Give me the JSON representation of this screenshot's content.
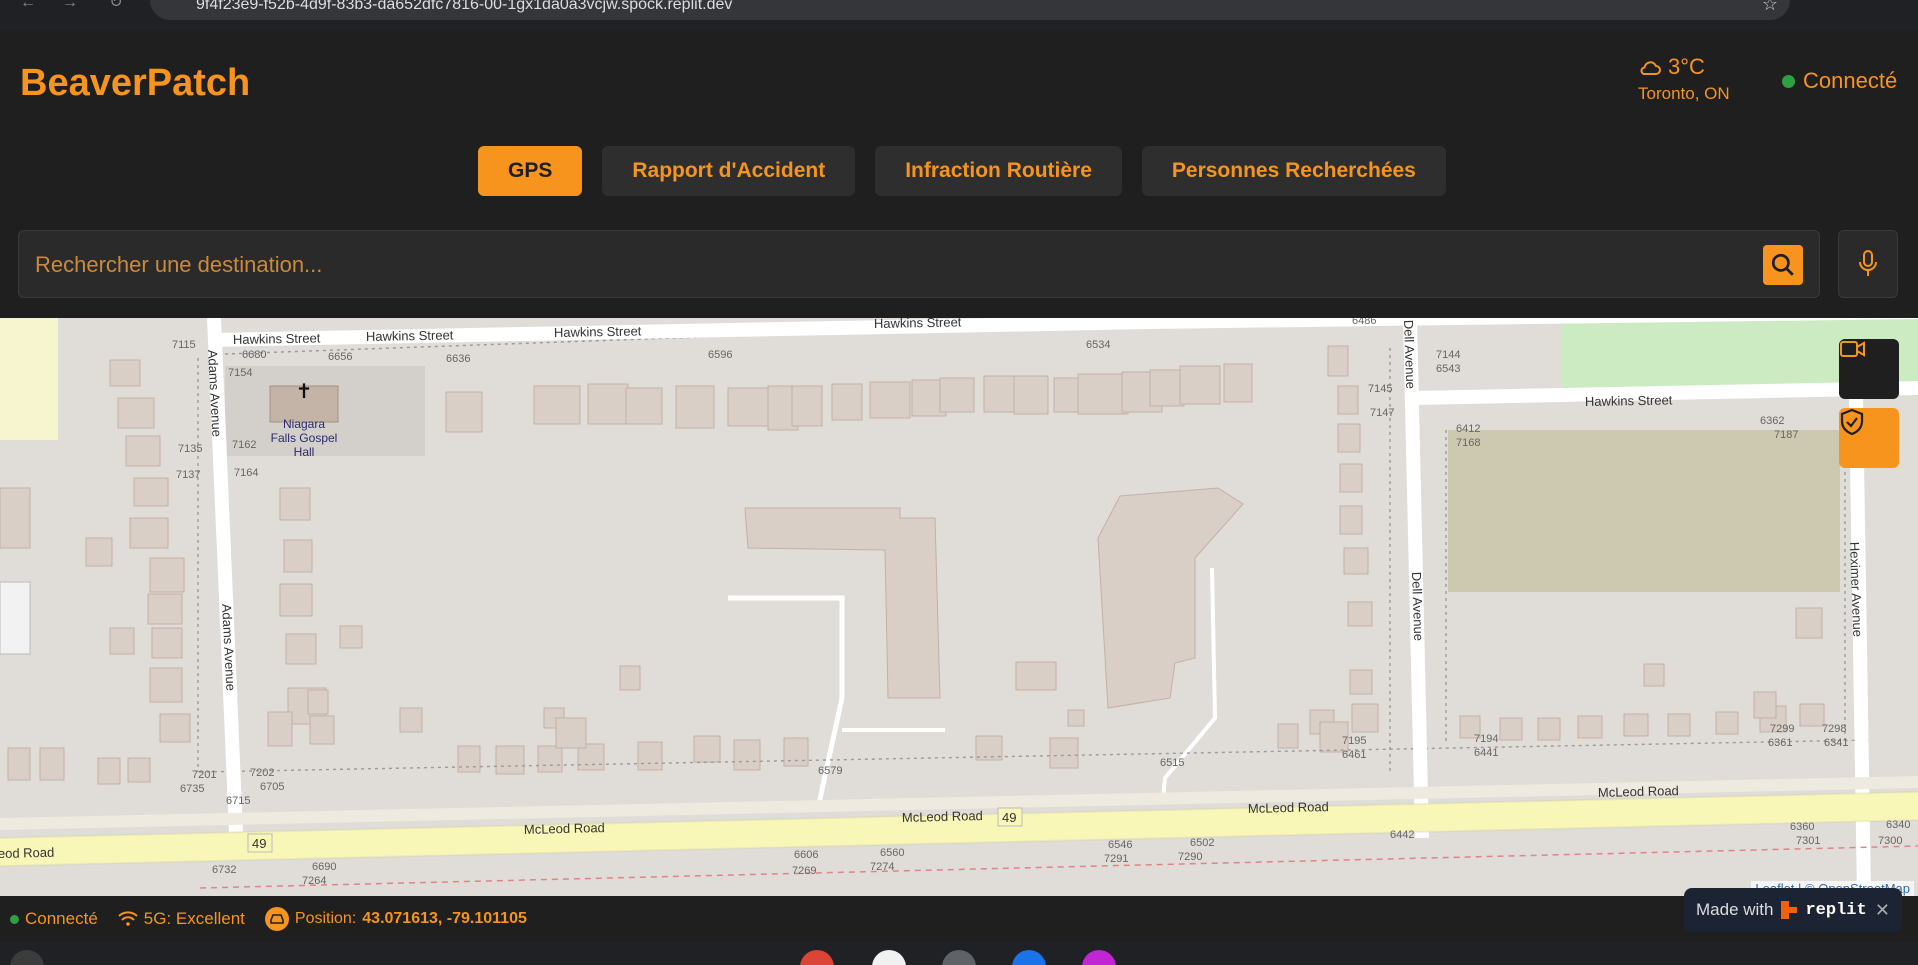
{
  "browser": {
    "url": "9f4f23e9-f52b-4d9f-83b3-da652dfc7816-00-1gx1da0a3vcjw.spock.replit.dev"
  },
  "header": {
    "logo": "BeaverPatch",
    "weather": {
      "temperature": "3°C",
      "city": "Toronto, ON",
      "icon": "cloud-icon"
    },
    "connection": "Connecté"
  },
  "tabs": [
    {
      "label": "GPS",
      "active": true
    },
    {
      "label": "Rapport d'Accident",
      "active": false
    },
    {
      "label": "Infraction Routière",
      "active": false
    },
    {
      "label": "Personnes Recherchées",
      "active": false
    }
  ],
  "search": {
    "placeholder": "Rechercher une destination...",
    "value": ""
  },
  "map": {
    "streets": {
      "hawkins": "Hawkins Street",
      "adams": "Adams Avenue",
      "dell": "Dell Avenue",
      "heximer": "Heximer Avenue",
      "mcleod": "McLeod Road",
      "mcleod_partial": "eod Road",
      "route_shield": "49"
    },
    "poi": {
      "name": "Niagara Falls Gospel Hall",
      "icon": "cross-icon"
    },
    "house_numbers": [
      "7115",
      "6680",
      "6656",
      "6636",
      "6596",
      "6534",
      "6486",
      "7154",
      "7162",
      "7135",
      "7164",
      "7137",
      "7145",
      "7147",
      "7144",
      "6543",
      "6412",
      "7168",
      "6362",
      "7187",
      "7195",
      "6461",
      "6515",
      "6579",
      "7201",
      "6735",
      "7202",
      "6705",
      "6715",
      "6732",
      "6690",
      "7264",
      "6606",
      "7269",
      "6560",
      "7274",
      "6546",
      "7291",
      "6502",
      "7290",
      "6442",
      "7194",
      "6441",
      "7299",
      "6361",
      "7298",
      "6341",
      "6360",
      "7301",
      "7300",
      "6340"
    ],
    "attribution": "Leaflet | © OpenStreetMap"
  },
  "status_bar": {
    "connection": "Connecté",
    "network": "5G: Excellent",
    "position_label": "Position:",
    "position_value": "43.071613, -79.101105"
  },
  "replit_badge": {
    "prefix": "Made with",
    "brand": "replit"
  },
  "colors": {
    "accent": "#f7941d",
    "background": "#1f1f1f",
    "online": "#2ea043"
  }
}
